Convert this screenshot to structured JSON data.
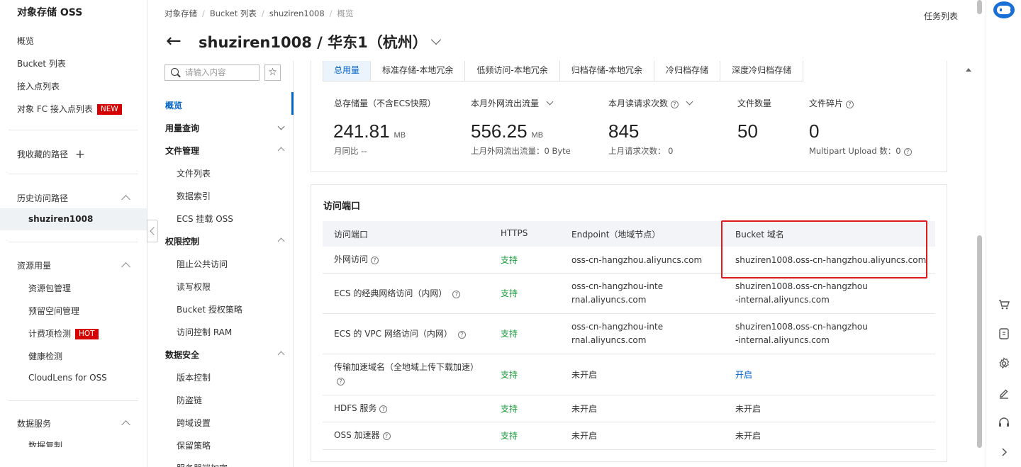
{
  "sidebar": {
    "title": "对象存储 OSS",
    "items": [
      "概览",
      "Bucket 列表",
      "接入点列表"
    ],
    "fc_item": {
      "label": "对象 FC 接入点列表",
      "badge": "NEW"
    },
    "favorites": "我收藏的路径",
    "history": {
      "label": "历史访问路径",
      "active": "shuziren1008"
    },
    "resource": {
      "label": "资源用量",
      "items": [
        "资源包管理",
        "预留空间管理"
      ],
      "hot_item": {
        "label": "计费项检测",
        "badge": "HOT"
      },
      "more": [
        "健康检测",
        "CloudLens for OSS"
      ]
    },
    "data_service": {
      "label": "数据服务",
      "sub": "数据复制"
    }
  },
  "breadcrumb": [
    "对象存储",
    "Bucket 列表",
    "shuziren1008",
    "概览"
  ],
  "task_list": "任务列表",
  "page_title": "shuziren1008 / 华东1（杭州）",
  "nav2": {
    "search_placeholder": "请输入内容",
    "overview": "概览",
    "usage": "用量查询",
    "file_mgmt": "文件管理",
    "file_items": [
      "文件列表",
      "数据索引",
      "ECS 挂载 OSS"
    ],
    "perm": "权限控制",
    "perm_items": [
      "阻止公共访问",
      "读写权限",
      "Bucket 授权策略",
      "访问控制 RAM"
    ],
    "security": "数据安全",
    "security_items": [
      "版本控制",
      "防盗链",
      "跨域设置",
      "保留策略",
      "服务器端加密"
    ]
  },
  "tabs": [
    "总用量",
    "标准存储-本地冗余",
    "低频访问-本地冗余",
    "归档存储-本地冗余",
    "冷归档存储",
    "深度冷归档存储"
  ],
  "stats": {
    "storage": {
      "label": "总存储量（不含ECS快照）",
      "value": "241.81",
      "unit": "MB",
      "sub": "月同比 --"
    },
    "traffic": {
      "label": "本月外网流出流量",
      "value": "556.25",
      "unit": "MB",
      "sub": "上月外网流出流量：0 Byte"
    },
    "requests": {
      "label": "本月读请求次数",
      "value": "845",
      "sub": "上月请求次数：  0"
    },
    "files": {
      "label": "文件数量",
      "value": "50"
    },
    "fragments": {
      "label": "文件碎片",
      "value": "0",
      "sub": "Multipart Upload 数：0"
    }
  },
  "access": {
    "title": "访问端口",
    "headers": [
      "访问端口",
      "HTTPS",
      "Endpoint（地域节点）",
      "Bucket 域名"
    ],
    "rows": [
      {
        "name": "外网访问",
        "https": "支持",
        "endpoint": "oss-cn-hangzhou.aliyuncs.com",
        "domain": "shuziren1008.oss-cn-hangzhou.aliyuncs.com"
      },
      {
        "name": "ECS 的经典网络访问（内网）",
        "https": "支持",
        "endpoint": "oss-cn-hangzhou-internal.aliyuncs.com",
        "domain": "shuziren1008.oss-cn-hangzhou-internal.aliyuncs.com"
      },
      {
        "name": "ECS 的 VPC 网络访问（内网）",
        "https": "支持",
        "endpoint": "oss-cn-hangzhou-internal.aliyuncs.com",
        "domain": "shuziren1008.oss-cn-hangzhou-internal.aliyuncs.com"
      },
      {
        "name": "传输加速域名（全地域上传下载加速）",
        "https": "支持",
        "endpoint": "未开启",
        "domain": "开启"
      },
      {
        "name": "HDFS 服务",
        "https": "支持",
        "endpoint": "未开启",
        "domain": "未开启"
      },
      {
        "name": "OSS 加速器",
        "https": "支持",
        "endpoint": "未开启",
        "domain": "未开启"
      }
    ]
  },
  "colors": {
    "accent": "#0064c8",
    "support_green": "#1a9b3c",
    "badge_red": "#d60000",
    "highlight_red": "#e0191b"
  }
}
